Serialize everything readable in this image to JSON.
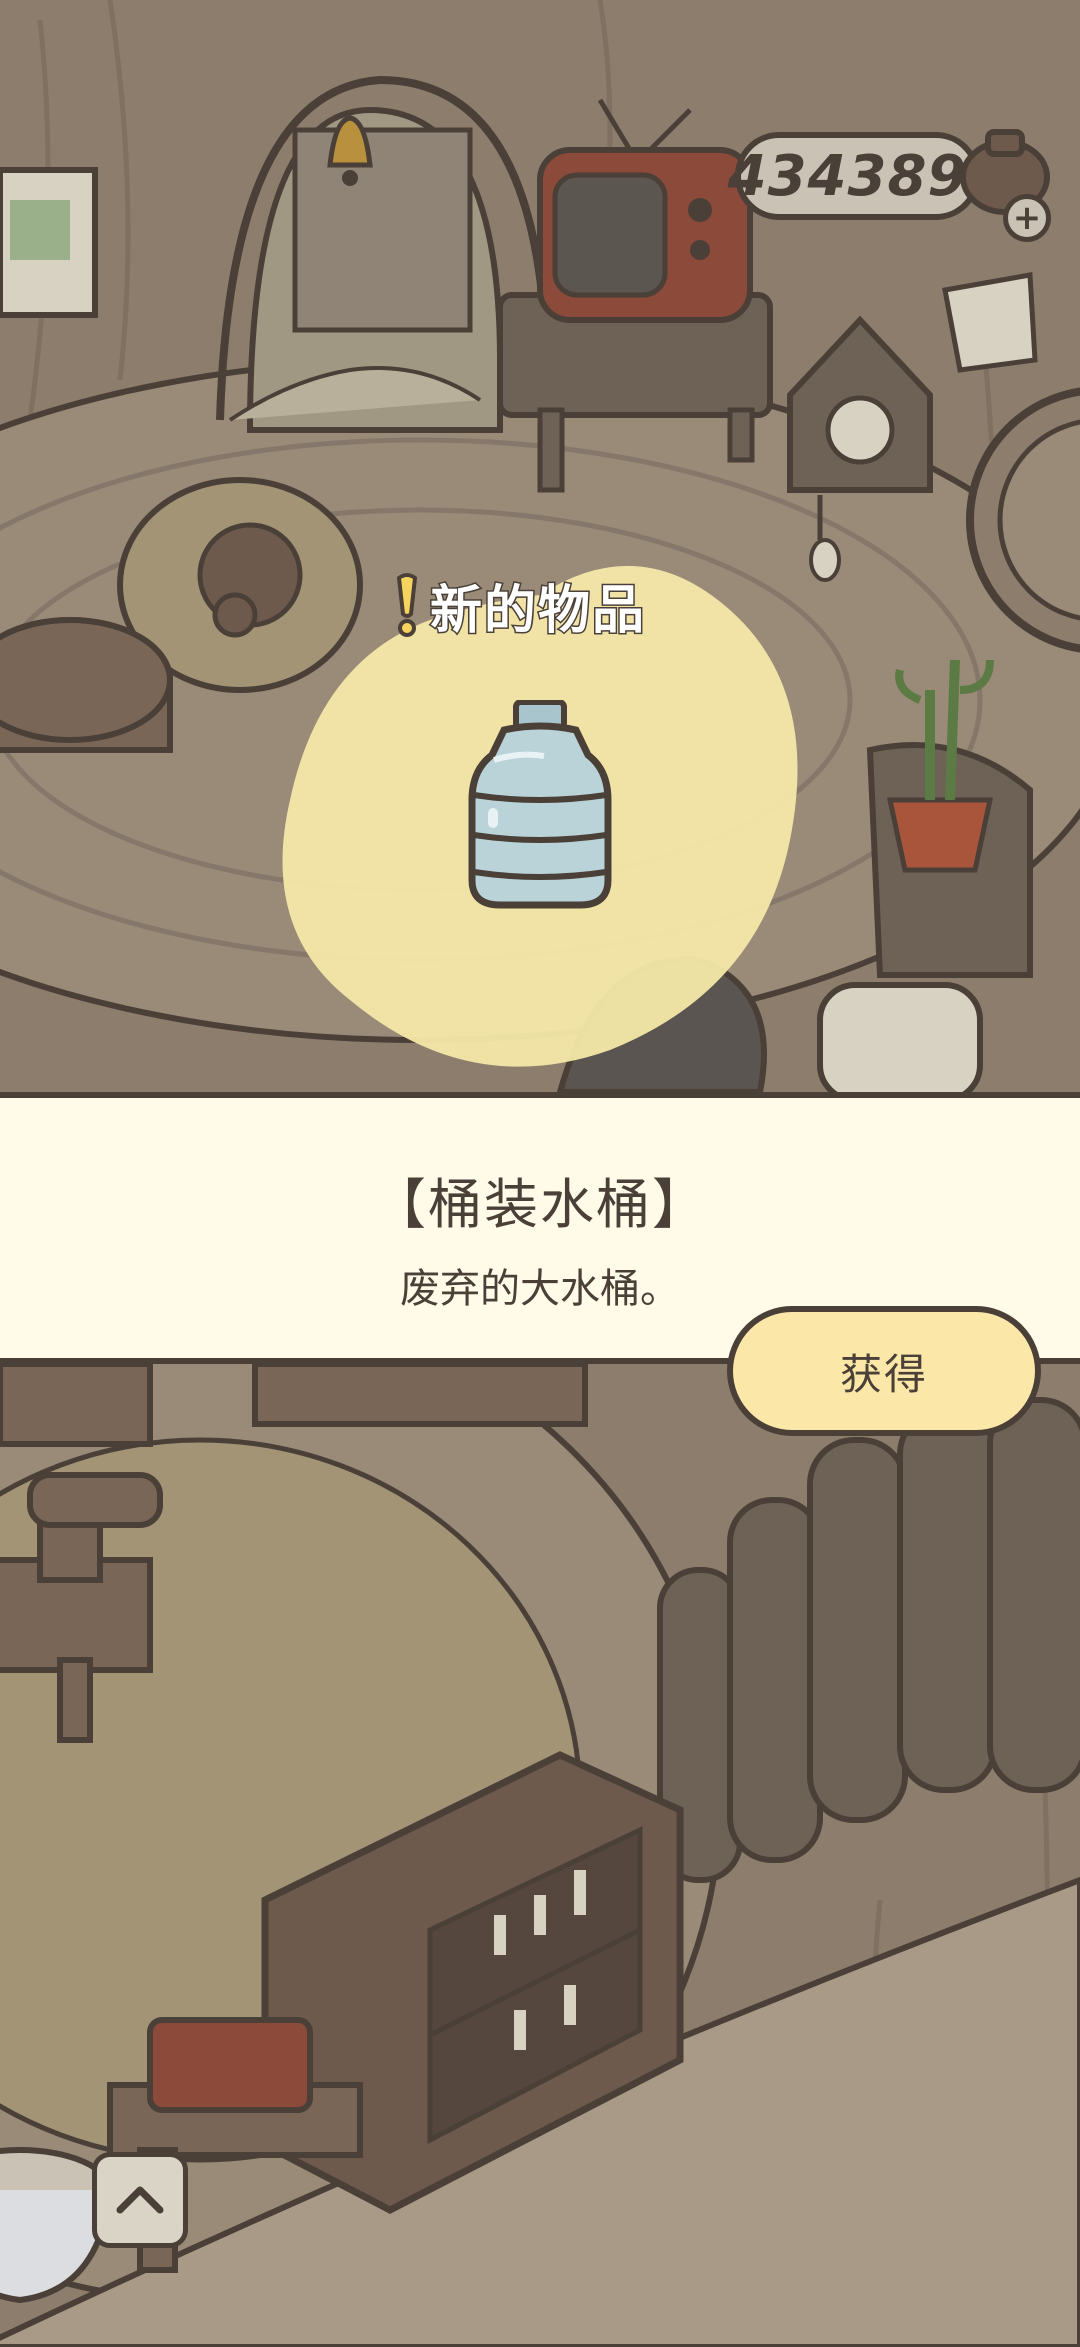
{
  "hud": {
    "currency_value": "434389",
    "currency_plus": "+"
  },
  "popup": {
    "header": "新的物品",
    "item_name": "【桶装水桶】",
    "item_description": "废弃的大水桶。",
    "obtain_label": "获得",
    "item_icon": "water-jug-icon"
  },
  "controls": {
    "scroll_up_icon": "chevron-up-icon"
  },
  "colors": {
    "outline": "#4a4038",
    "panel": "#fffbe8",
    "button": "#fbe8a8",
    "highlight_blob": "#f4e8a8",
    "floor": "#8d7d6d"
  }
}
